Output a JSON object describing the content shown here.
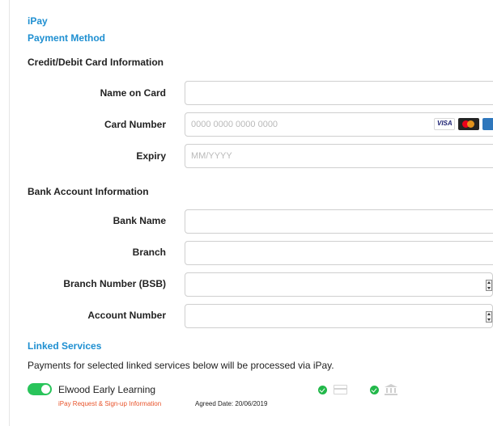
{
  "header": {
    "app_title": "iPay",
    "page_title": "Payment Method"
  },
  "card_section": {
    "title": "Credit/Debit Card Information",
    "fields": [
      {
        "label": "Name on Card",
        "value": "",
        "placeholder": ""
      },
      {
        "label": "Card Number",
        "value": "",
        "placeholder": "0000 0000 0000 0000"
      },
      {
        "label": "Expiry",
        "value": "",
        "placeholder": "MM/YYYY"
      }
    ],
    "card_brands": [
      {
        "name": "VISA",
        "icon": "visa-icon",
        "color": "#1a1f71"
      },
      {
        "name": "Mastercard",
        "icon": "mastercard-icon",
        "color": "#eb001b"
      },
      {
        "name": "Amex",
        "icon": "amex-icon",
        "color": "#2e77bc"
      }
    ]
  },
  "bank_section": {
    "title": "Bank Account Information",
    "fields": [
      {
        "label": "Bank Name",
        "value": ""
      },
      {
        "label": "Branch",
        "value": ""
      },
      {
        "label": "Branch Number (BSB)",
        "value": ""
      },
      {
        "label": "Account Number",
        "value": ""
      }
    ]
  },
  "linked_services": {
    "title": "Linked Services",
    "description": "Payments for selected linked services below will be processed via iPay.",
    "items": [
      {
        "name": "Elwood Early Learning",
        "enabled": true,
        "info_link": "iPay Request & Sign-up Information",
        "agreed_date": "Agreed Date: 20/06/2019",
        "card_linked": true,
        "bank_linked": true
      }
    ]
  },
  "colors": {
    "accent": "#1e8fd1",
    "toggle_on": "#29c45a",
    "check": "#22b84a",
    "link_red": "#e8542b"
  }
}
